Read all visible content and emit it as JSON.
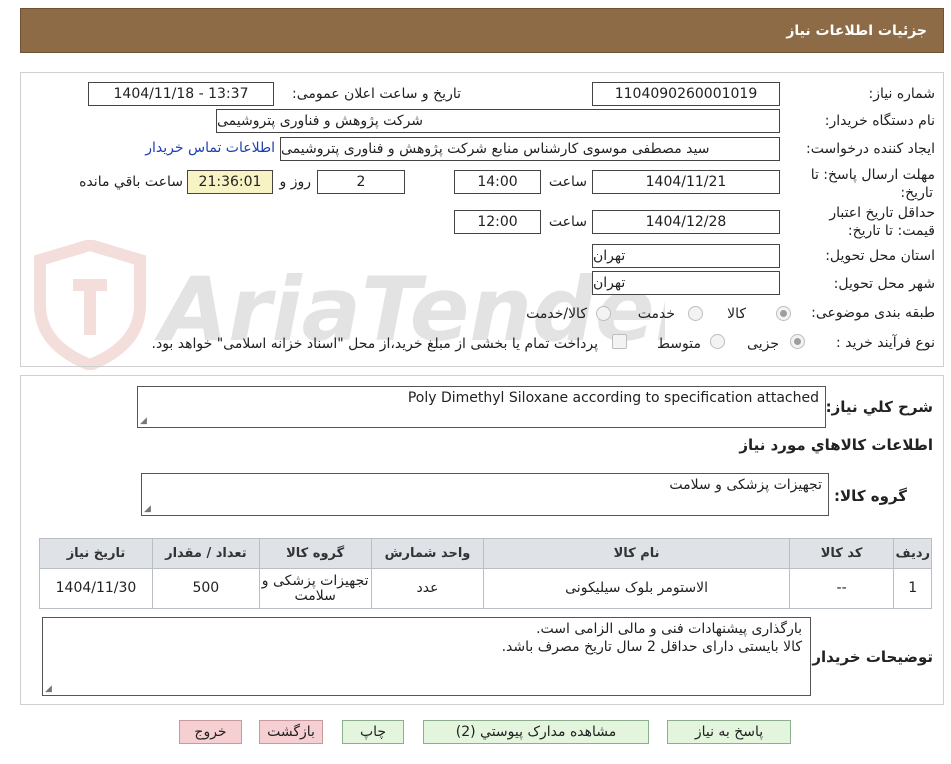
{
  "header": {
    "title": "جزئیات اطلاعات نیاز"
  },
  "form": {
    "need_number_label": "شماره نیاز:",
    "need_number": "1104090260001019",
    "announce_label": "تاریخ و ساعت اعلان عمومی:",
    "announce_value": "1404/11/18 - 13:37",
    "buyer_org_label": "نام دستگاه خریدار:",
    "buyer_org": "شرکت پژوهش و فناوری پتروشیمی",
    "creator_label": "ایجاد کننده درخواست:",
    "creator": "سید مصطفی موسوی کارشناس منابع شرکت پژوهش و فناوری پتروشیمی",
    "contact_link": "اطلاعات تماس خریدار",
    "reply_deadline_label_1": "مهلت ارسال پاسخ: تا",
    "reply_deadline_label_2": "تاریخ:",
    "reply_date": "1404/11/21",
    "time_label": "ساعت",
    "reply_time": "14:00",
    "days_value": "2",
    "days_label": "روز و",
    "remaining_time": "21:36:01",
    "remaining_label": "ساعت باقي مانده",
    "validity_label_1": "حداقل تاریخ اعتبار",
    "validity_label_2": "قیمت: تا تاریخ:",
    "validity_date": "1404/12/28",
    "validity_time": "12:00",
    "province_label": "استان محل تحویل:",
    "province": "تهران",
    "city_label": "شهر محل تحویل:",
    "city": "تهران",
    "category_label": "طبقه بندی موضوعی:",
    "category_options": [
      "کالا",
      "خدمت",
      "کالا/خدمت"
    ],
    "category_selected": "کالا",
    "process_label": "نوع فرآیند خرید :",
    "process_options": [
      "جزیی",
      "متوسط"
    ],
    "payment_note": "پرداخت تمام یا بخشی از مبلغ خرید،از محل \"اسناد خزانه اسلامی\" خواهد بود."
  },
  "description": {
    "label": "شرح كلي نياز:",
    "value": "Poly Dimethyl  Siloxane according to specification attached"
  },
  "goods": {
    "section_title": "اطلاعات کالاهاي مورد نياز",
    "group_label": "گروه کالا:",
    "group_value": "تجهیزات پزشکی و سلامت",
    "columns": [
      "رديف",
      "کد کالا",
      "نام کالا",
      "واحد شمارش",
      "گروه کالا",
      "تعداد / مقدار",
      "تاریخ نیاز"
    ],
    "rows": [
      {
        "row": "1",
        "code": "--",
        "name": "الاستومر بلوک سیلیکونی",
        "unit": "عدد",
        "group_line1": "تجهیزات پزشکی و",
        "group_line2": "سلامت",
        "qty": "500",
        "date": "1404/11/30"
      }
    ]
  },
  "buyer_notes": {
    "label": "توضیحات خریدار:",
    "line1": "بارگذاری پیشنهادات فنی و مالی الزامی است.",
    "line2": "کالا بایستی دارای حداقل 2 سال تاریخ مصرف باشد."
  },
  "buttons": {
    "reply": "پاسخ به نیاز",
    "attachments": "مشاهده مدارک پیوستي (2)",
    "print": "چاپ",
    "back": "بازگشت",
    "exit": "خروج"
  },
  "watermark": {
    "text": "AriaTender.neT"
  },
  "colors": {
    "header_bg": "#8d6b47",
    "button_green": "#e3f5dd",
    "button_pink": "#f6cfd3",
    "remaining_bg": "#f8f3c4",
    "link": "#1a3fb5"
  }
}
